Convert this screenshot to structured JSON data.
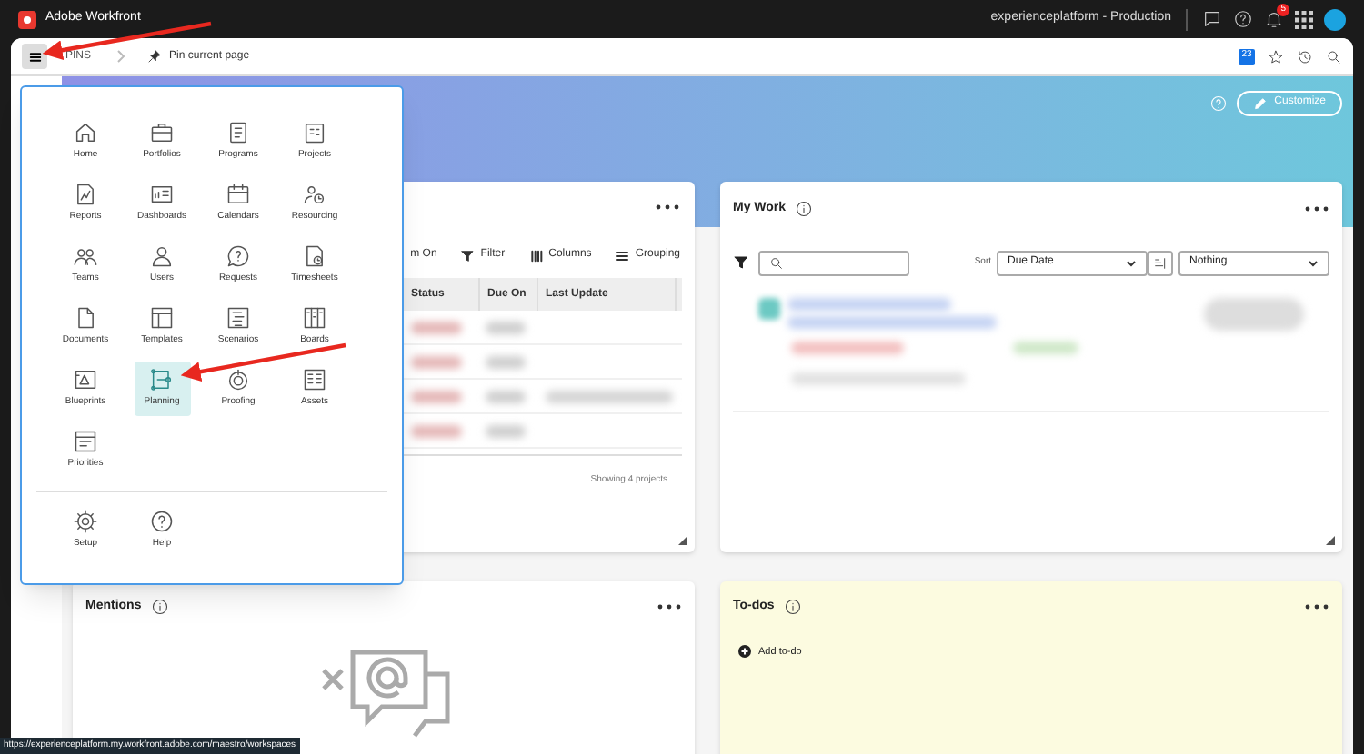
{
  "app_bar": {
    "title": "Adobe Workfront",
    "org": "experienceplatform - Production",
    "notification_count": "5"
  },
  "header": {
    "breadcrumb": "PINS",
    "pin_label": "Pin current page",
    "calendar_day": "23"
  },
  "banner": {
    "customize": "Customize"
  },
  "menu": {
    "items": [
      {
        "label": "Home",
        "selected": false
      },
      {
        "label": "Portfolios",
        "selected": false
      },
      {
        "label": "Programs",
        "selected": false
      },
      {
        "label": "Projects",
        "selected": false
      },
      {
        "label": "Reports",
        "selected": false
      },
      {
        "label": "Dashboards",
        "selected": false
      },
      {
        "label": "Calendars",
        "selected": false
      },
      {
        "label": "Resourcing",
        "selected": false
      },
      {
        "label": "Teams",
        "selected": false
      },
      {
        "label": "Users",
        "selected": false
      },
      {
        "label": "Requests",
        "selected": false
      },
      {
        "label": "Timesheets",
        "selected": false
      },
      {
        "label": "Documents",
        "selected": false
      },
      {
        "label": "Templates",
        "selected": false
      },
      {
        "label": "Scenarios",
        "selected": false
      },
      {
        "label": "Boards",
        "selected": false
      },
      {
        "label": "Blueprints",
        "selected": false
      },
      {
        "label": "Planning",
        "selected": true
      },
      {
        "label": "Proofing",
        "selected": false
      },
      {
        "label": "Assets",
        "selected": false
      },
      {
        "label": "Priorities",
        "selected": false
      }
    ],
    "footer": [
      {
        "label": "Setup"
      },
      {
        "label": "Help"
      }
    ]
  },
  "projects_widget": {
    "toolbar": [
      "m On",
      "Filter",
      "Columns",
      "Grouping"
    ],
    "columns": [
      "Status",
      "Due On",
      "Last Update"
    ],
    "footer": "Showing 4 projects"
  },
  "my_work": {
    "title": "My Work",
    "sort_label": "Sort",
    "sort_value": "Due Date",
    "group_value": "Nothing"
  },
  "mentions": {
    "title": "Mentions"
  },
  "todos": {
    "title": "To-dos",
    "add_label": "Add to-do"
  },
  "status_url": "https://experienceplatform.my.workfront.adobe.com/maestro/workspaces"
}
